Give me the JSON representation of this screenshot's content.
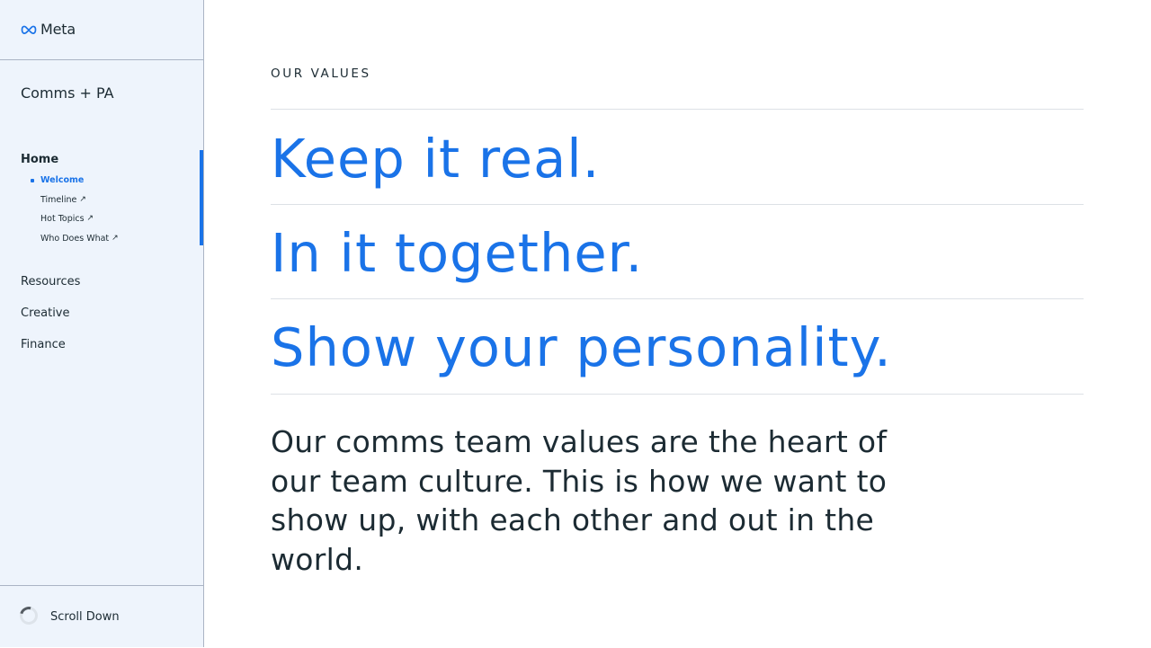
{
  "sidebar": {
    "brand": "Meta",
    "section_title": "Comms + PA",
    "home_label": "Home",
    "subnav": [
      {
        "label": "Welcome",
        "active": true,
        "external": false
      },
      {
        "label": "Timeline",
        "active": false,
        "external": true
      },
      {
        "label": "Hot Topics",
        "active": false,
        "external": true
      },
      {
        "label": "Who Does What",
        "active": false,
        "external": true
      }
    ],
    "main_items": [
      "Resources",
      "Creative",
      "Finance"
    ],
    "external_icon": "↗",
    "footer_label": "Scroll Down"
  },
  "main": {
    "eyebrow": "OUR VALUES",
    "values": [
      "Keep it real.",
      "In it together.",
      "Show your personality."
    ],
    "body": "Our comms team values are the heart of our team culture. This is how we want to show up, with each other and out in the world."
  },
  "colors": {
    "accent": "#1a73e8",
    "text": "#1c2b33",
    "sidebar_bg": "#eef4fc"
  }
}
